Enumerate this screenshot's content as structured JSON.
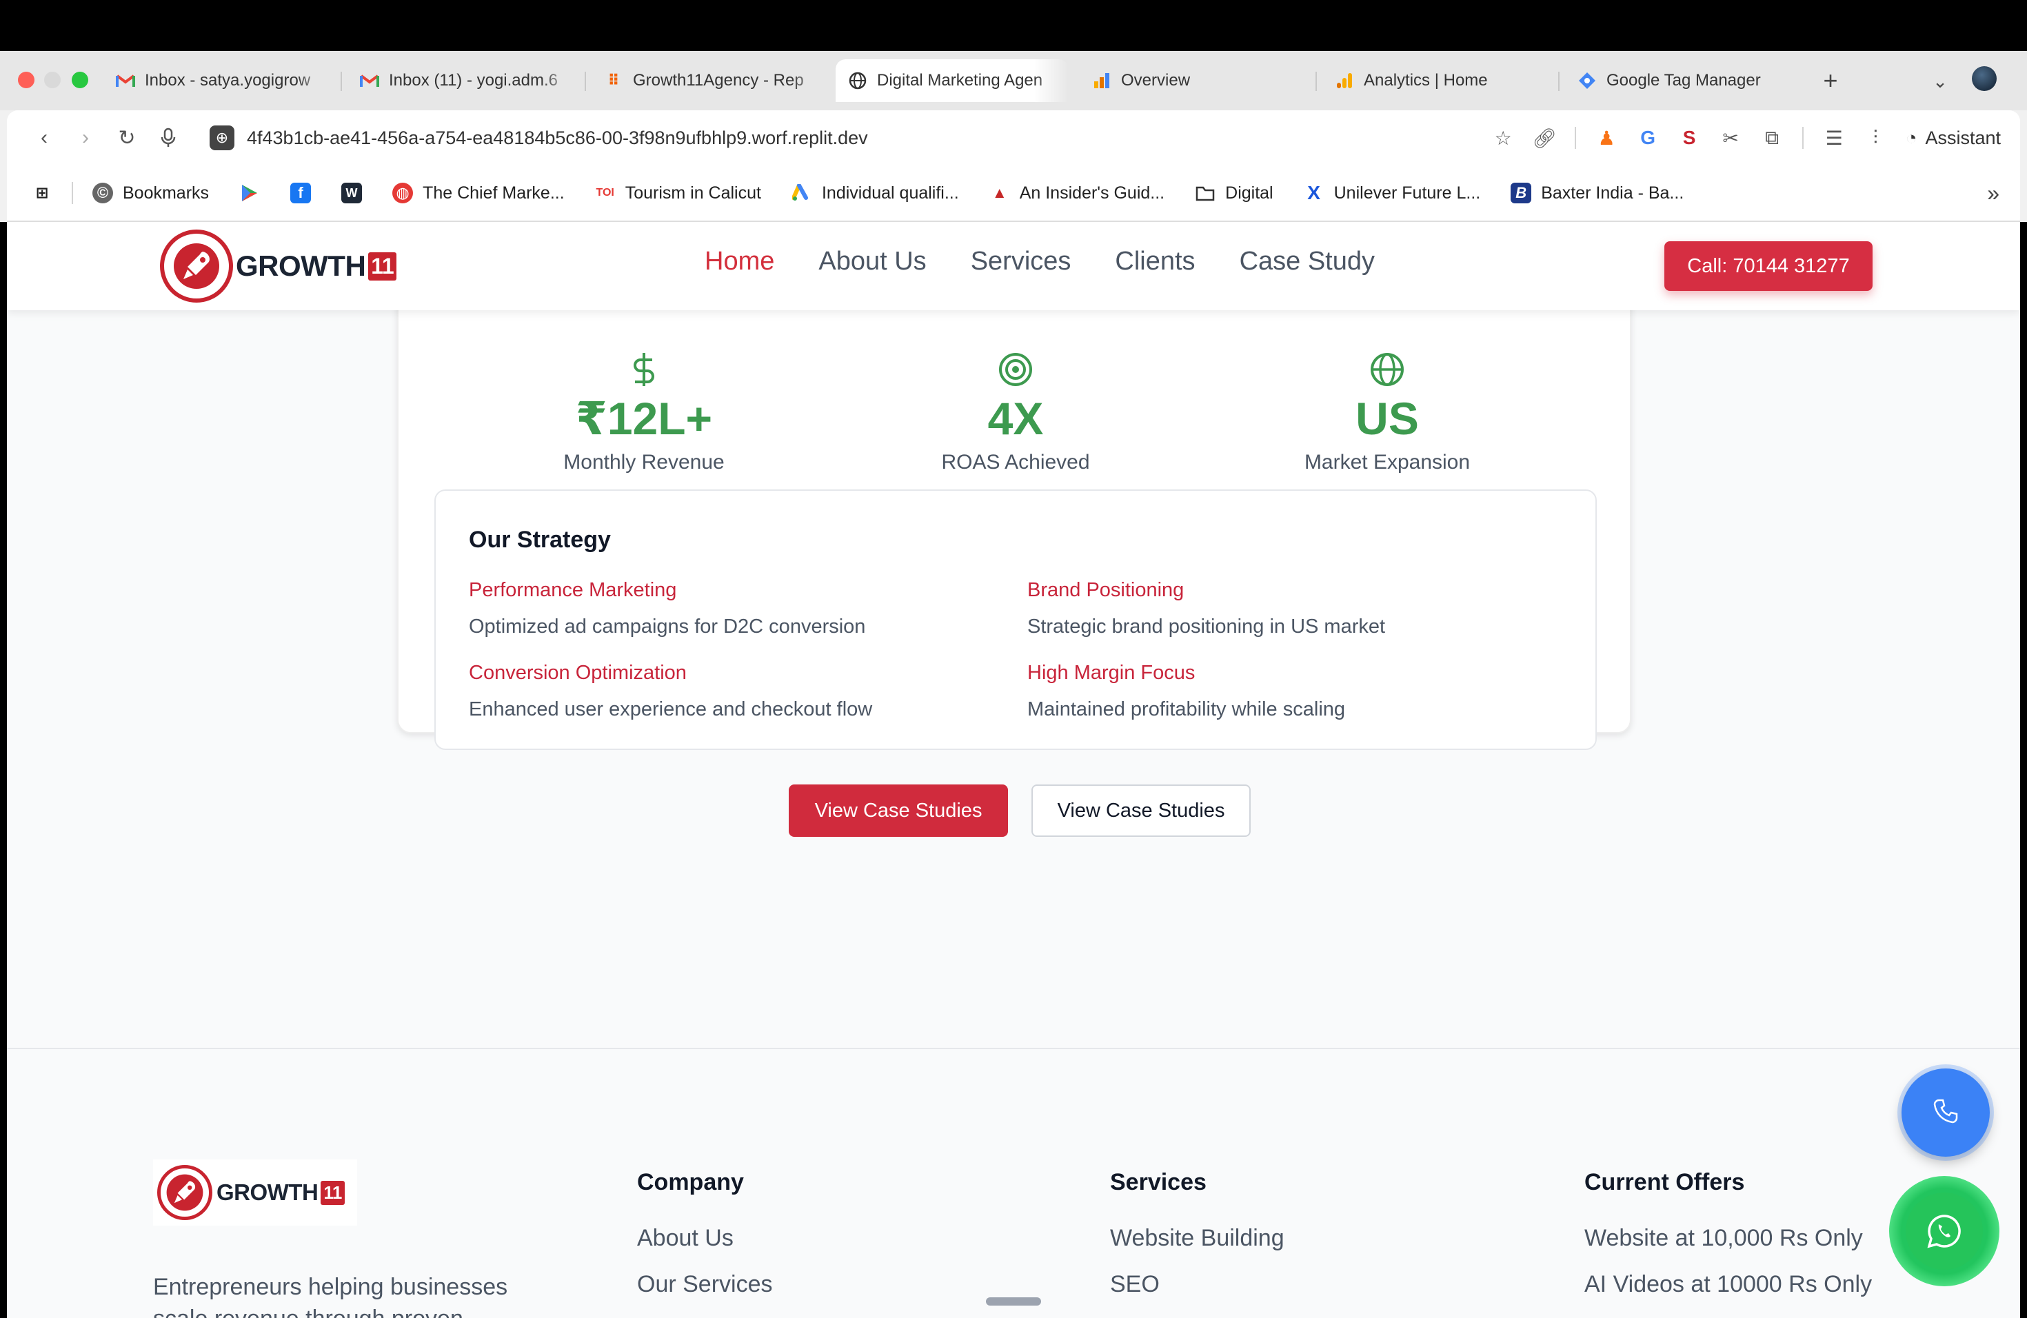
{
  "browser": {
    "tabs": [
      {
        "label": "Inbox - satya.yogigrow",
        "icon": "gmail-icon"
      },
      {
        "label": "Inbox (11) - yogi.adm.6",
        "icon": "gmail-icon"
      },
      {
        "label": "Growth11Agency - Rep",
        "icon": "replit-icon"
      },
      {
        "label": "Digital Marketing Agen",
        "icon": "globe-icon"
      },
      {
        "label": "Overview",
        "icon": "analytics-icon"
      },
      {
        "label": "Analytics | Home",
        "icon": "analytics-icon"
      },
      {
        "label": "Google Tag Manager",
        "icon": "tag-manager-icon"
      }
    ],
    "url": "4f43b1cb-ae41-456a-a754-ea48184b5c86-00-3f98n9ufbhlp9.worf.replit.dev",
    "assistant_label": "Assistant",
    "bookmarks": [
      {
        "label": "Bookmarks",
        "icon": "bookmarks-icon"
      },
      {
        "label": "",
        "icon": "play-store-icon"
      },
      {
        "label": "",
        "icon": "facebook-icon"
      },
      {
        "label": "",
        "icon": "w-icon"
      },
      {
        "label": "The Chief Marke...",
        "icon": "cmo-icon"
      },
      {
        "label": "Tourism in Calicut",
        "icon": "toi-icon"
      },
      {
        "label": "Individual qualifi...",
        "icon": "google-ads-icon"
      },
      {
        "label": "An Insider's Guid...",
        "icon": "mica-icon"
      },
      {
        "label": "Digital",
        "icon": "folder-icon"
      },
      {
        "label": "Unilever Future L...",
        "icon": "x-icon"
      },
      {
        "label": "Baxter India - Ba...",
        "icon": "baxter-icon"
      }
    ]
  },
  "header": {
    "logo_text": "GROWTH",
    "logo_num": "11",
    "nav": [
      "Home",
      "About Us",
      "Services",
      "Clients",
      "Case Study"
    ],
    "active_nav": "Home",
    "call_label": "Call: 70144 31277"
  },
  "stats": [
    {
      "value": "₹12L+",
      "label": "Monthly Revenue",
      "icon": "dollar-icon"
    },
    {
      "value": "4X",
      "label": "ROAS Achieved",
      "icon": "target-icon"
    },
    {
      "value": "US",
      "label": "Market Expansion",
      "icon": "globe-icon"
    }
  ],
  "strategy": {
    "title": "Our Strategy",
    "items": [
      {
        "title": "Performance Marketing",
        "desc": "Optimized ad campaigns for D2C conversion"
      },
      {
        "title": "Brand Positioning",
        "desc": "Strategic brand positioning in US market"
      },
      {
        "title": "Conversion Optimization",
        "desc": "Enhanced user experience and checkout flow"
      },
      {
        "title": "High Margin Focus",
        "desc": "Maintained profitability while scaling"
      }
    ]
  },
  "buttons": {
    "primary": "View Case Studies",
    "secondary": "View Case Studies"
  },
  "footer": {
    "tagline": "Entrepreneurs helping businesses scale revenue through proven",
    "columns": [
      {
        "title": "Company",
        "links": [
          "About Us",
          "Our Services"
        ]
      },
      {
        "title": "Services",
        "links": [
          "Website Building",
          "SEO"
        ]
      },
      {
        "title": "Current Offers",
        "links": [
          "Website at 10,000 Rs Only",
          "AI Videos at 10000 Rs Only"
        ]
      }
    ]
  },
  "colors": {
    "brand_red": "#d32f3c",
    "stat_green": "#3d9a4f",
    "phone_fab": "#3b82f6",
    "whatsapp_fab": "#25c45a"
  }
}
